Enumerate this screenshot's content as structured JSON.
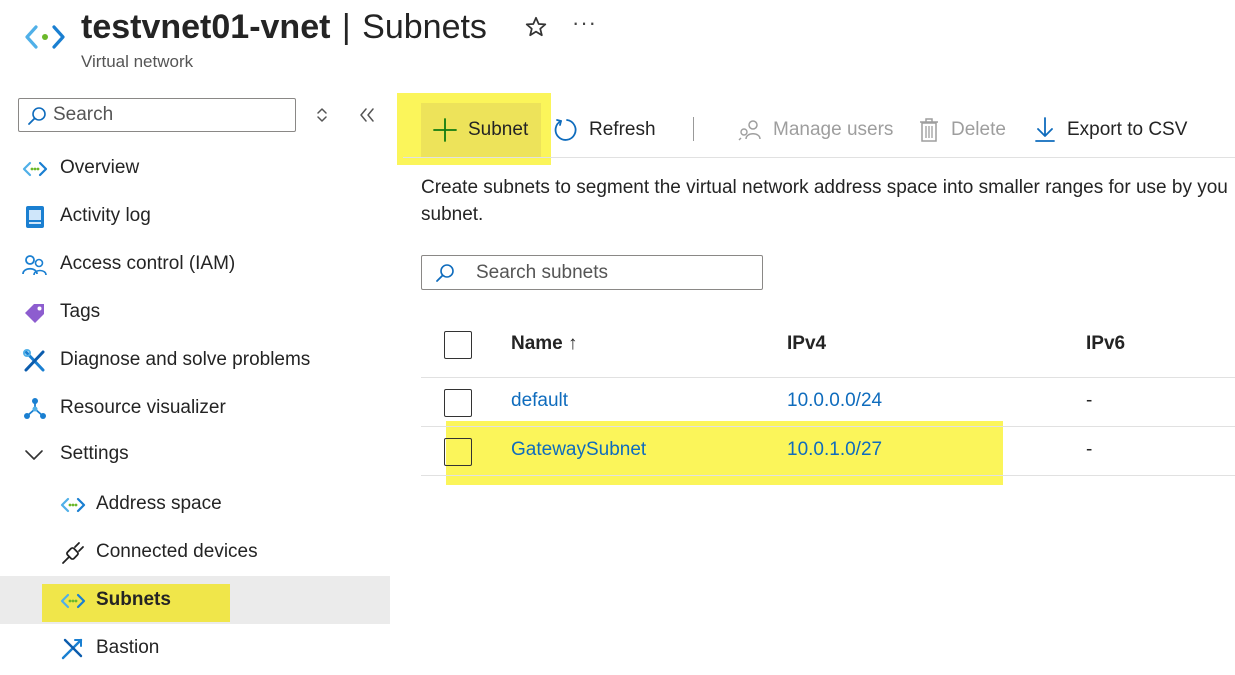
{
  "header": {
    "title_bold": "testvnet01-vnet",
    "title_sep": "|",
    "title_rest": "Subnets",
    "subtitle": "Virtual network",
    "more": "···"
  },
  "sidebar": {
    "search_placeholder": "Search",
    "items": [
      {
        "label": "Overview",
        "icon": "vnet-icon"
      },
      {
        "label": "Activity log",
        "icon": "activity-log-icon"
      },
      {
        "label": "Access control (IAM)",
        "icon": "iam-icon"
      },
      {
        "label": "Tags",
        "icon": "tag-icon"
      },
      {
        "label": "Diagnose and solve problems",
        "icon": "wrench-icon"
      },
      {
        "label": "Resource visualizer",
        "icon": "visualizer-icon"
      },
      {
        "label": "Settings",
        "icon": "chevron-down-icon"
      },
      {
        "label": "Address space",
        "icon": "vnet-icon"
      },
      {
        "label": "Connected devices",
        "icon": "plug-icon"
      },
      {
        "label": "Subnets",
        "icon": "vnet-icon",
        "active": true
      },
      {
        "label": "Bastion",
        "icon": "bastion-icon"
      }
    ]
  },
  "toolbar": {
    "add_label": "Subnet",
    "refresh_label": "Refresh",
    "manage_label": "Manage users",
    "delete_label": "Delete",
    "export_label": "Export to CSV"
  },
  "main": {
    "description_line1": "Create subnets to segment the virtual network address space into smaller ranges for use by you",
    "description_line2": "subnet.",
    "search_placeholder": "Search subnets"
  },
  "table": {
    "columns": {
      "name": "Name ↑",
      "ipv4": "IPv4",
      "ipv6": "IPv6"
    },
    "rows": [
      {
        "name": "default",
        "ipv4": "10.0.0.0/24",
        "ipv6": "-"
      },
      {
        "name": "GatewaySubnet",
        "ipv4": "10.0.1.0/27",
        "ipv6": "-"
      }
    ]
  },
  "colors": {
    "accent_blue": "#0f6cbd",
    "highlight_yellow": "#fbf55a",
    "active_bg": "#ebebeb"
  }
}
